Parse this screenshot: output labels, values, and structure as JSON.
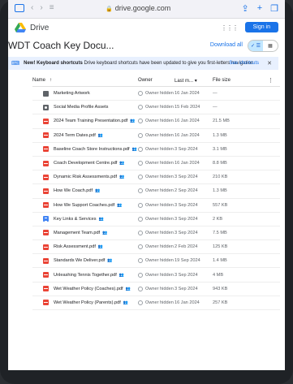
{
  "browser": {
    "url": "drive.google.com"
  },
  "drive": {
    "app_name": "Drive",
    "signin_label": "Sign in"
  },
  "folder": {
    "title": "WDT Coach Key Docu...",
    "download_all_label": "Download all",
    "view_list": "✓ ☰",
    "view_grid": "▦"
  },
  "banner": {
    "bold_text": "New! Keyboard shortcuts",
    "text": "Drive keyboard shortcuts have been updated to give you first-letters navigation",
    "link": "See shortcuts",
    "close": "✕"
  },
  "table": {
    "headers": {
      "name": "Name",
      "owner": "Owner",
      "modified": "Last m...",
      "size": "File size"
    },
    "rows": [
      {
        "type": "folder",
        "name": "Marketing Artwork",
        "shared": false,
        "owner": "Owner hidden",
        "modified": "16 Jan 2024",
        "size": "—"
      },
      {
        "type": "folder-shared",
        "name": "Social Media Profile Assets",
        "shared": false,
        "owner": "Owner hidden",
        "modified": "15 Feb 2024",
        "size": "—"
      },
      {
        "type": "pdf",
        "name": "2024 Team Training Presentation.pdf",
        "shared": true,
        "owner": "Owner hidden",
        "modified": "16 Jan 2024",
        "size": "21.5 MB"
      },
      {
        "type": "pdf",
        "name": "2024 Term Dates.pdf",
        "shared": true,
        "owner": "Owner hidden",
        "modified": "16 Jan 2024",
        "size": "1.3 MB"
      },
      {
        "type": "pdf",
        "name": "Baseline Coach Store Instructions.pdf",
        "shared": true,
        "owner": "Owner hidden",
        "modified": "3 Sep 2024",
        "size": "3.1 MB"
      },
      {
        "type": "pdf",
        "name": "Coach Development Centre.pdf",
        "shared": true,
        "owner": "Owner hidden",
        "modified": "16 Jan 2024",
        "size": "8.8 MB"
      },
      {
        "type": "pdf",
        "name": "Dynamic Risk Assessments.pdf",
        "shared": true,
        "owner": "Owner hidden",
        "modified": "3 Sep 2024",
        "size": "210 KB"
      },
      {
        "type": "pdf",
        "name": "How We Coach.pdf",
        "shared": true,
        "owner": "Owner hidden",
        "modified": "2 Sep 2024",
        "size": "1.3 MB"
      },
      {
        "type": "pdf",
        "name": "How We Support Coaches.pdf",
        "shared": true,
        "owner": "Owner hidden",
        "modified": "3 Sep 2024",
        "size": "557 KB"
      },
      {
        "type": "doc",
        "name": "Key Links & Services",
        "shared": true,
        "owner": "Owner hidden",
        "modified": "3 Sep 2024",
        "size": "2 KB"
      },
      {
        "type": "pdf",
        "name": "Management Team.pdf",
        "shared": true,
        "owner": "Owner hidden",
        "modified": "3 Sep 2024",
        "size": "7.5 MB"
      },
      {
        "type": "pdf",
        "name": "Risk Assessment.pdf",
        "shared": true,
        "owner": "Owner hidden",
        "modified": "2 Feb 2024",
        "size": "125 KB"
      },
      {
        "type": "pdf",
        "name": "Standards We Deliver.pdf",
        "shared": true,
        "owner": "Owner hidden",
        "modified": "19 Sep 2024",
        "size": "1.4 MB"
      },
      {
        "type": "pdf",
        "name": "Unleashing Tennis Together.pdf",
        "shared": true,
        "owner": "Owner hidden",
        "modified": "3 Sep 2024",
        "size": "4 MB"
      },
      {
        "type": "pdf",
        "name": "Wet Weather Policy (Coaches).pdf",
        "shared": true,
        "owner": "Owner hidden",
        "modified": "3 Sep 2024",
        "size": "943 KB"
      },
      {
        "type": "pdf",
        "name": "Wet Weather Policy (Parents).pdf",
        "shared": true,
        "owner": "Owner hidden",
        "modified": "16 Jan 2024",
        "size": "257 KB"
      }
    ]
  },
  "colors": {
    "accent": "#1a73e8",
    "pdf": "#ea4335",
    "doc": "#4285f4",
    "folder": "#5f6368",
    "banner_bg": "#e8f0fe"
  }
}
